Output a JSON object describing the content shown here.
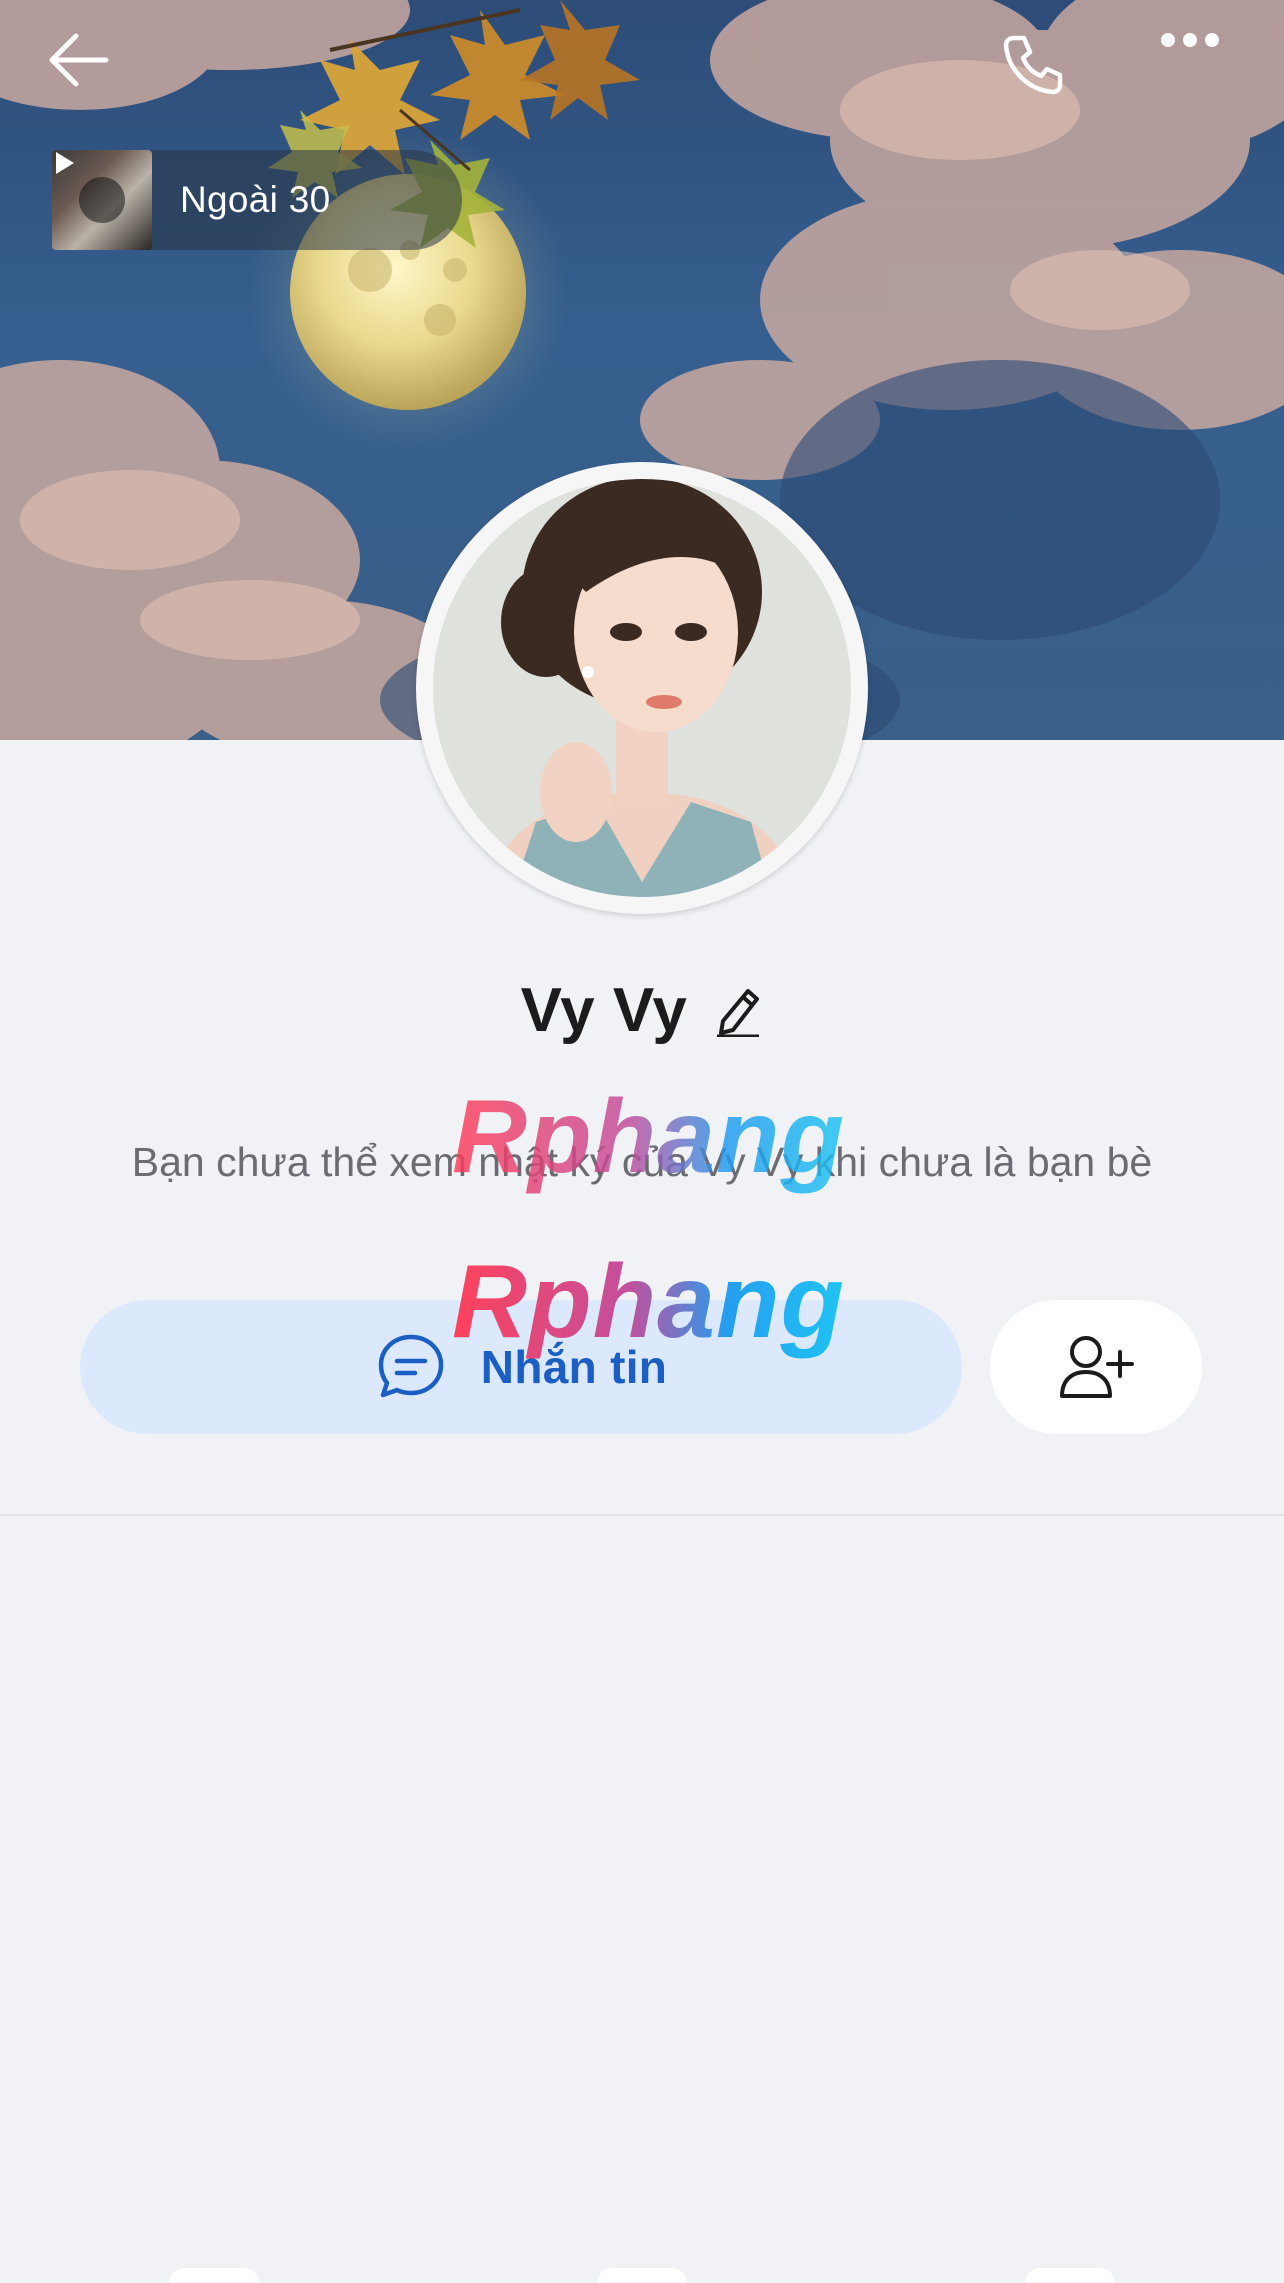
{
  "header": {
    "back_icon": "arrow-left-icon",
    "call_icon": "phone-icon",
    "more_icon": "ellipsis-icon"
  },
  "music": {
    "title": "Ngoài 30",
    "icon": "play-icon"
  },
  "profile": {
    "name": "Vy Vy",
    "edit_icon": "pencil-icon",
    "notice": "Bạn chưa thể xem nhật ký của Vy Vy khi chưa là bạn bè"
  },
  "actions": {
    "message_label": "Nhắn tin",
    "message_icon": "chat-bubble-icon",
    "add_friend_icon": "user-plus-icon"
  },
  "watermark": {
    "text": "Rphang"
  },
  "colors": {
    "background": "#f1f2f6",
    "accent": "#1b5fc4",
    "message_button_bg": "#dce9fd",
    "text_primary": "#1c1c1e",
    "text_secondary": "#6a6c72"
  }
}
